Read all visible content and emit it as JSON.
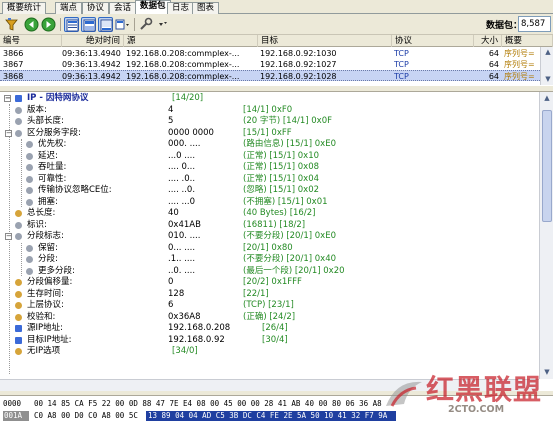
{
  "tabs": [
    "概要统计",
    "端点",
    "协议",
    "会话",
    "数据包",
    "日志",
    "图表"
  ],
  "active_tab": 4,
  "toolbar": {
    "icons": [
      "filter-icon",
      "back-arrow-icon",
      "forward-arrow-icon",
      "view-list-icon",
      "view-tree-icon",
      "view-hex-icon",
      "view-menu-icon",
      "settings-icon",
      "tools-icon"
    ],
    "packet_count_label": "数据包：",
    "packet_count_value": "8,587"
  },
  "packet_table": {
    "columns": [
      "编号",
      "绝对时间",
      "源",
      "目标",
      "协议",
      "大小",
      "概要"
    ],
    "rows": [
      {
        "no": "3866",
        "time": "09:36:13.494066",
        "src": "192.168.0.208:commplex-...",
        "dst": "192.168.0.92:1030",
        "proto": "TCP",
        "size": "64",
        "summary": "序列号="
      },
      {
        "no": "3867",
        "time": "09:36:13.494211",
        "src": "192.168.0.208:commplex-...",
        "dst": "192.168.0.92:1027",
        "proto": "TCP",
        "size": "64",
        "summary": "序列号="
      },
      {
        "no": "3868",
        "time": "09:36:13.494254",
        "src": "192.168.0.208:commplex-...",
        "dst": "192.168.0.92:1028",
        "proto": "TCP",
        "size": "64",
        "summary": "序列号="
      }
    ],
    "selected_row": 2
  },
  "decode_tree": {
    "root": {
      "label": "IP - 因特网协议",
      "offset": "[14/20]"
    },
    "nodes": [
      {
        "label": "版本:",
        "value": "4",
        "comment": "[14/1]  0xF0"
      },
      {
        "label": "头部长度:",
        "value": "5",
        "comment": "(20 字节)  [14/1]  0x0F"
      },
      {
        "label": "区分服务字段:",
        "value": "0000 0000",
        "comment": "[15/1]  0xFF"
      },
      {
        "label": "优先权:",
        "value": "000. ....",
        "comment": "(路由信息)  [15/1]  0xE0"
      },
      {
        "label": "延迟:",
        "value": "...0 ....",
        "comment": "(正常)  [15/1]  0x10"
      },
      {
        "label": "吞吐量:",
        "value": ".... 0...",
        "comment": "(正常)  [15/1]  0x08"
      },
      {
        "label": "可靠性:",
        "value": ".... .0..",
        "comment": "(正常)  [15/1]  0x04"
      },
      {
        "label": "传输协议忽略CE位:",
        "value": ".... ..0.",
        "comment": "(忽略)  [15/1]  0x02"
      },
      {
        "label": "拥塞:",
        "value": ".... ...0",
        "comment": "(不拥塞)  [15/1]  0x01"
      },
      {
        "label": "总长度:",
        "value": "40",
        "comment": "(40 Bytes)  [16/2]"
      },
      {
        "label": "标识:",
        "value": "0x41AB",
        "comment": "(16811)  [18/2]"
      },
      {
        "label": "分段标志:",
        "value": "010. ....",
        "comment": "(不要分段)  [20/1]  0xE0"
      },
      {
        "label": "保留:",
        "value": "0... ....",
        "comment": "[20/1]  0x80"
      },
      {
        "label": "分段:",
        "value": ".1.. ....",
        "comment": "(不要分段)  [20/1]  0x40"
      },
      {
        "label": "更多分段:",
        "value": "..0. ....",
        "comment": "(最后一个段)  [20/1]  0x20"
      },
      {
        "label": "分段偏移量:",
        "value": "0",
        "comment": "[20/2]  0x1FFF"
      },
      {
        "label": "生存时间:",
        "value": "128",
        "comment": "[22/1]"
      },
      {
        "label": "上层协议:",
        "value": "6",
        "comment": "(TCP)  [23/1]"
      },
      {
        "label": "校验和:",
        "value": "0x36A8",
        "comment": "(正确)  [24/2]"
      },
      {
        "label": "源IP地址:",
        "value": "192.168.0.208",
        "comment": "[26/4]"
      },
      {
        "label": "目标IP地址:",
        "value": "192.168.0.92",
        "comment": "[30/4]"
      },
      {
        "label": "无IP选项",
        "value": "",
        "comment": "[34/0]"
      }
    ]
  },
  "hex": {
    "rows": [
      {
        "offset": "0000",
        "bytes": "00 14 85 CA F5 22 00 0D 88 47 7E E4 08 00 45 00 00 28 41 AB 40 00 80 06 36 A8"
      },
      {
        "offset": "001A",
        "bytes_before": "C0 A8 00 D0 C0 A8 00 5C",
        "bytes_selected": "13 89 04 04 AD C5 3B DC C4 FE 2E 5A 50 10 41 32 F7 9A"
      }
    ]
  },
  "watermark": {
    "text": "红黑联盟",
    "url": "2CTO.COM"
  },
  "colors": {
    "selected_row": "#c7d4f4",
    "hex_selection": "#1f3fa0",
    "comment_green": "#238a23",
    "root_blue": "#1a2a9a",
    "summary_orange": "#b07a00"
  }
}
